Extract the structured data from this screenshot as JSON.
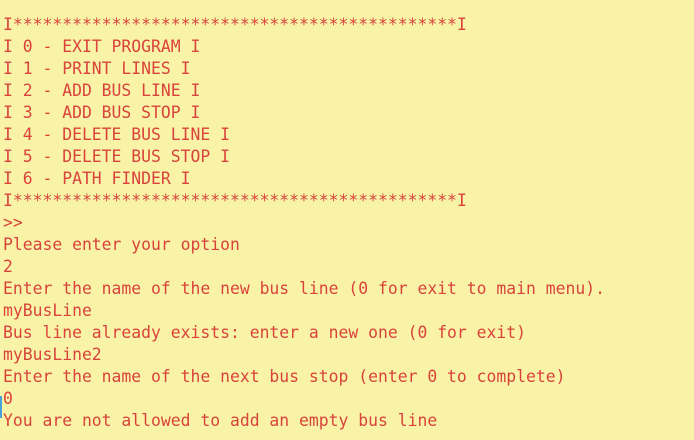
{
  "console": {
    "lines": [
      "I*********************************************I",
      "I 0 - EXIT PROGRAM I",
      "I 1 - PRINT LINES I",
      "I 2 - ADD BUS LINE I",
      "I 3 - ADD BUS STOP I",
      "I 4 - DELETE BUS LINE I",
      "I 5 - DELETE BUS STOP I",
      "I 6 - PATH FINDER I",
      "I*********************************************I",
      ">>",
      "Please enter your option",
      "2",
      "Enter the name of the new bus line (0 for exit to main menu).",
      "myBusLine",
      "Bus line already exists: enter a new one (0 for exit)",
      "myBusLine2",
      "Enter the name of the next bus stop (enter 0 to complete)",
      "0",
      "You are not allowed to add an empty bus line"
    ]
  },
  "colors": {
    "background": "#f9f3a7",
    "text": "#d9433c",
    "cursor": "#4aa0d8"
  }
}
